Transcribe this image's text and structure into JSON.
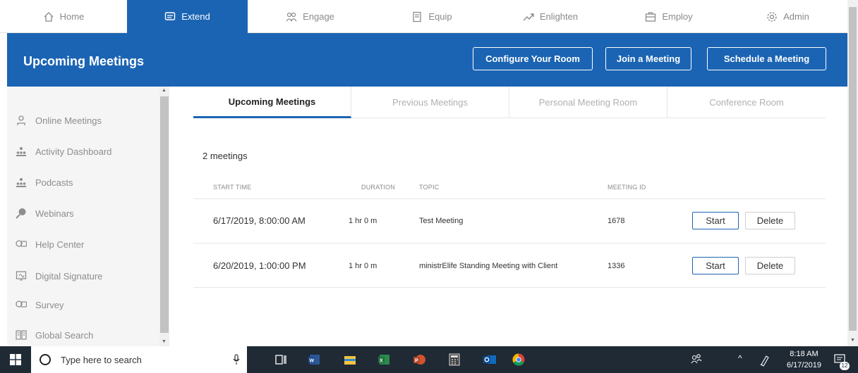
{
  "topnav": {
    "items": [
      {
        "label": "Home",
        "icon": "home-icon"
      },
      {
        "label": "Extend",
        "icon": "chat-icon"
      },
      {
        "label": "Engage",
        "icon": "people-icon"
      },
      {
        "label": "Equip",
        "icon": "document-icon"
      },
      {
        "label": "Enlighten",
        "icon": "trend-icon"
      },
      {
        "label": "Employ",
        "icon": "briefcase-icon"
      },
      {
        "label": "Admin",
        "icon": "gear-icon"
      }
    ],
    "active": "Extend"
  },
  "header": {
    "title": "Upcoming Meetings",
    "buttons": {
      "configure": "Configure Your Room",
      "join": "Join a Meeting",
      "schedule": "Schedule a Meeting"
    }
  },
  "sidebar": {
    "items": [
      {
        "label": "Online Meetings",
        "icon": "person-icon"
      },
      {
        "label": "Activity Dashboard",
        "icon": "group-icon"
      },
      {
        "label": "Podcasts",
        "icon": "group-icon"
      },
      {
        "label": "Webinars",
        "icon": "globe-mic-icon"
      },
      {
        "label": "Help Center",
        "icon": "help-icon"
      },
      {
        "label": "Digital Signature",
        "icon": "signature-icon"
      },
      {
        "label": "Survey",
        "icon": "survey-icon"
      },
      {
        "label": "Global Search",
        "icon": "search-grid-icon"
      }
    ]
  },
  "tabs": [
    {
      "label": "Upcoming Meetings",
      "active": true
    },
    {
      "label": "Previous Meetings",
      "active": false
    },
    {
      "label": "Personal Meeting Room",
      "active": false
    },
    {
      "label": "Conference Room",
      "active": false
    }
  ],
  "meetings": {
    "count_label": "2 meetings",
    "columns": {
      "start_time": "START TIME",
      "duration": "DURATION",
      "topic": "TOPIC",
      "meeting_id": "MEETING ID"
    },
    "rows": [
      {
        "start_time": "6/17/2019, 8:00:00 AM",
        "duration": "1 hr 0 m",
        "topic": "Test Meeting",
        "meeting_id": "1678",
        "start_label": "Start",
        "delete_label": "Delete"
      },
      {
        "start_time": "6/20/2019, 1:00:00 PM",
        "duration": "1 hr 0 m",
        "topic": "ministrElife Standing Meeting with Client",
        "meeting_id": "1336",
        "start_label": "Start",
        "delete_label": "Delete"
      }
    ]
  },
  "taskbar": {
    "search_placeholder": "Type here to search",
    "time": "8:18 AM",
    "date": "6/17/2019",
    "notification_count": "12"
  },
  "colors": {
    "brand_blue": "#1b64b3",
    "taskbar": "#1f2a35"
  }
}
